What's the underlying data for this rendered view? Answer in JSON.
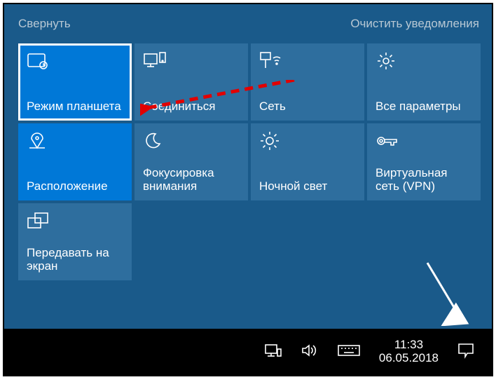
{
  "header": {
    "collapse": "Свернуть",
    "clear": "Очистить уведомления"
  },
  "tiles": [
    {
      "id": "tablet-mode",
      "label": "Режим планшета",
      "icon": "tablet-mode",
      "active": true,
      "selected": true
    },
    {
      "id": "connect",
      "label": "Соединиться",
      "icon": "connect",
      "active": false,
      "selected": false
    },
    {
      "id": "network",
      "label": "Сеть",
      "icon": "network",
      "active": false,
      "selected": false
    },
    {
      "id": "all-settings",
      "label": "Все параметры",
      "icon": "settings",
      "active": false,
      "selected": false
    },
    {
      "id": "location",
      "label": "Расположение",
      "icon": "location",
      "active": true,
      "selected": false
    },
    {
      "id": "focus-assist",
      "label": "Фокусировка внимания",
      "icon": "moon",
      "active": false,
      "selected": false
    },
    {
      "id": "night-light",
      "label": "Ночной свет",
      "icon": "sun",
      "active": false,
      "selected": false
    },
    {
      "id": "vpn",
      "label": "Виртуальная сеть (VPN)",
      "icon": "vpn",
      "active": false,
      "selected": false
    },
    {
      "id": "project",
      "label": "Передавать на экран",
      "icon": "project",
      "active": false,
      "selected": false
    }
  ],
  "taskbar": {
    "time": "11:33",
    "date": "06.05.2018"
  }
}
